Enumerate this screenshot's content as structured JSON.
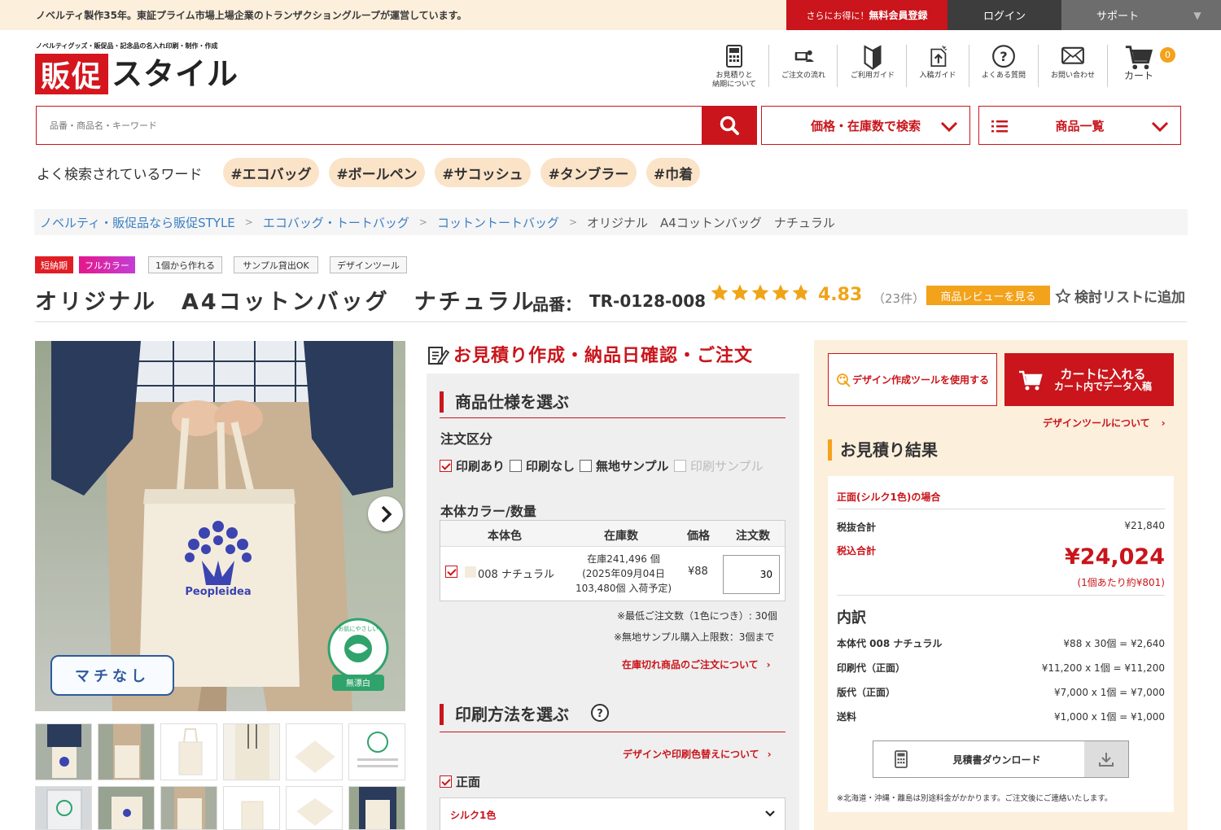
{
  "topbar": {
    "message": "ノベルティ製作35年。東証プライム市場上場企業のトランザクショングループが運営しています。",
    "register_small": "さらにお得に！",
    "register_big": "無料会員登録",
    "login": "ログイン",
    "support": "サポート"
  },
  "logo": {
    "tagline": "ノベルティグッズ・販促品・記念品の名入れ印刷・制作・作成",
    "box_text": "販促",
    "text": "スタイル"
  },
  "header_icons": [
    {
      "label1": "お見積りと",
      "label2": "納期について",
      "icon": "calculator-icon"
    },
    {
      "label1": "ご注文の流れ",
      "label2": "",
      "icon": "order-flow-icon"
    },
    {
      "label1": "ご利用ガイド",
      "label2": "",
      "icon": "beginner-mark-icon"
    },
    {
      "label1": "入稿ガイド",
      "label2": "",
      "icon": "upload-icon"
    },
    {
      "label1": "よくある質問",
      "label2": "",
      "icon": "question-icon"
    },
    {
      "label1": "お問い合わせ",
      "label2": "",
      "icon": "mail-icon"
    },
    {
      "label1": "カート",
      "label2": "",
      "icon": "cart-icon"
    }
  ],
  "cart_count": "0",
  "search": {
    "placeholder": "品番・商品名・キーワード",
    "price_search": "価格・在庫数で検索",
    "price_search_bold": "で検索",
    "product_list": "商品一覧"
  },
  "popular": {
    "label": "よく検索されているワード",
    "tags": [
      "#エコバッグ",
      "#ボールペン",
      "#サコッシュ",
      "#タンブラー",
      "#巾着"
    ]
  },
  "breadcrumb": [
    "ノベルティ・販促品なら販促STYLE",
    "エコバッグ・トートバッグ",
    "コットントートバッグ",
    "オリジナル　A4コットンバッグ　ナチュラル"
  ],
  "badges": [
    "短納期",
    "フルカラー",
    "1個から作れる",
    "サンプル貸出OK",
    "デザインツール"
  ],
  "product": {
    "title": "オリジナル　A4コットンバッグ　ナチュラル",
    "code_label": "品番：",
    "code": "TR-0128-008",
    "rating": "4.83",
    "rating_value": 4.83,
    "review_count": "（23件）",
    "review_button": "商品レビューを見る",
    "wishlist": "検討リストに追加"
  },
  "gallery": {
    "machi_label": "マチなし",
    "bag_logo_text": "Peopleidea",
    "eco_stamp_top": "お肌にやさしい",
    "eco_stamp_bottom": "無漂白"
  },
  "order": {
    "heading": "お見積り作成・納品日確認・ご注文",
    "spec_heading": "商品仕様を選ぶ",
    "order_type_label": "注文区分",
    "options": [
      {
        "label": "印刷あり",
        "checked": true,
        "disabled": false
      },
      {
        "label": "印刷なし",
        "checked": false,
        "disabled": false
      },
      {
        "label": "無地サンプル",
        "checked": false,
        "disabled": false
      },
      {
        "label": "印刷サンプル",
        "checked": false,
        "disabled": true
      }
    ],
    "color_qty_label": "本体カラー/数量",
    "table_headers": [
      "本体色",
      "在庫数",
      "価格",
      "注文数"
    ],
    "row": {
      "color": "008 ナチュラル",
      "stock1": "在庫241,496 個",
      "stock2": "(2025年09月04日",
      "stock3": "103,480個 入荷予定)",
      "price": "¥88",
      "qty": "30"
    },
    "note_min": "※最低ご注文数（1色につき）: 30個",
    "note_sample": "※無地サンプル購入上限数：3個まで",
    "stockout_link": "在庫切れ商品のご注文について",
    "print_heading": "印刷方法を選ぶ",
    "design_link": "デザインや印刷色替えについて",
    "front_label": "正面",
    "print_method": "シルク1色"
  },
  "right": {
    "design_tool_button": "デザイン作成ツールを使用する",
    "cart_button1": "カートに入れる",
    "cart_button2": "カート内でデータ入稿",
    "design_tool_link": "デザインツールについて",
    "result_heading": "お見積り結果",
    "case_label": "正面(シルク1色)の場合",
    "subtotal_label": "税抜合計",
    "subtotal": "¥21,840",
    "total_label": "税込合計",
    "total": "¥24,024",
    "per_unit": "(1個あたり約¥801)",
    "breakdown_heading": "内訳",
    "breakdown": [
      {
        "k": "本体代 008 ナチュラル",
        "v": "¥88 x 30個 = ¥2,640"
      },
      {
        "k": "印刷代（正面）",
        "v": "¥11,200 x 1個 = ¥11,200"
      },
      {
        "k": "版代（正面）",
        "v": "¥7,000 x 1個 = ¥7,000"
      },
      {
        "k": "送料",
        "v": "¥1,000 x 1個 = ¥1,000"
      }
    ],
    "download_button": "見積書ダウンロード",
    "footnote": "※北海道・沖縄・離島は別途料金がかかります。ご注文後にご連絡いたします。"
  },
  "colors": {
    "brand_red": "#c9151b",
    "accent_orange": "#f3a21b",
    "cream": "#fcefdc",
    "link_blue": "#3b7fc4"
  }
}
